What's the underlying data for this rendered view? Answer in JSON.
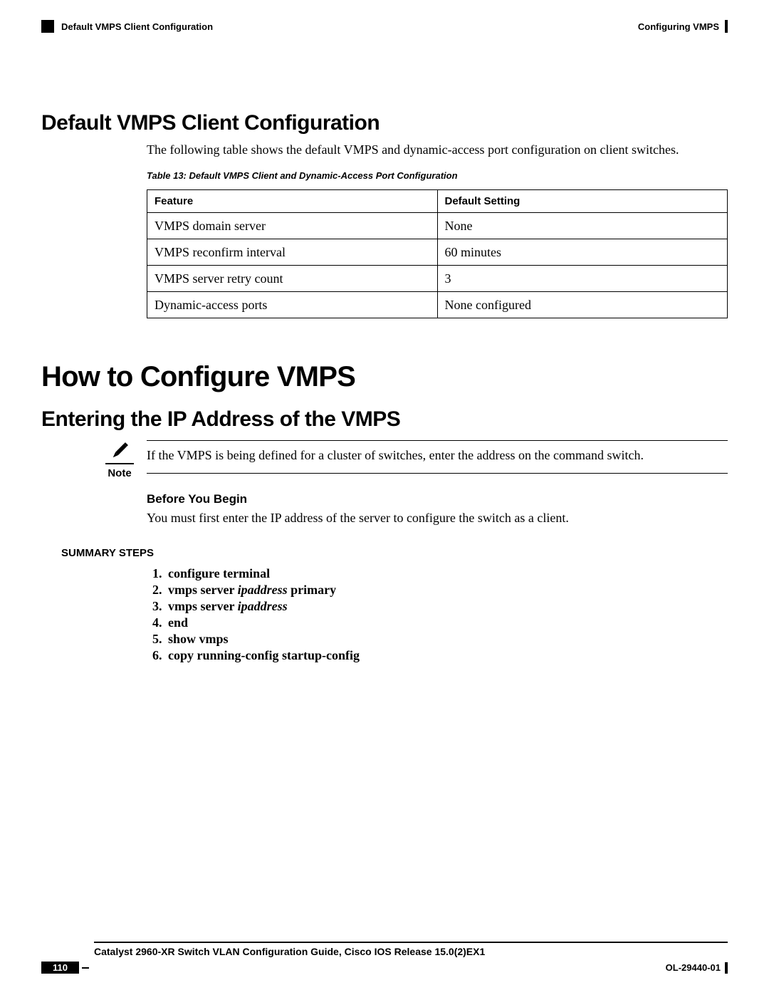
{
  "header": {
    "left_section": "Default VMPS Client Configuration",
    "right_chapter": "Configuring VMPS"
  },
  "section1": {
    "title": "Default VMPS Client Configuration",
    "intro": "The following table shows the default VMPS and dynamic-access port configuration on client switches.",
    "table_caption": "Table 13: Default VMPS Client and Dynamic-Access Port Configuration",
    "table": {
      "headers": [
        "Feature",
        "Default Setting"
      ],
      "rows": [
        [
          "VMPS domain server",
          "None"
        ],
        [
          "VMPS reconfirm interval",
          "60 minutes"
        ],
        [
          "VMPS server retry count",
          "3"
        ],
        [
          "Dynamic-access ports",
          "None configured"
        ]
      ]
    }
  },
  "section2": {
    "title": "How to Configure VMPS",
    "subtitle": "Entering the IP Address of the VMPS",
    "note_label": "Note",
    "note_text": "If the VMPS is being defined for a cluster of switches, enter the address on the command switch.",
    "byb_label": "Before You Begin",
    "byb_text": "You must first enter the IP address of the server to configure the switch as a client.",
    "summary_label": "SUMMARY STEPS",
    "steps": [
      {
        "pre": "configure terminal"
      },
      {
        "pre": "vmps server ",
        "it": "ipaddress",
        "post": " primary"
      },
      {
        "pre": "vmps server ",
        "it": "ipaddress"
      },
      {
        "pre": "end"
      },
      {
        "pre": "show vmps"
      },
      {
        "pre": "copy running-config startup-config"
      }
    ]
  },
  "footer": {
    "title": "Catalyst 2960-XR Switch VLAN Configuration Guide, Cisco IOS Release 15.0(2)EX1",
    "page": "110",
    "doc_id": "OL-29440-01"
  }
}
